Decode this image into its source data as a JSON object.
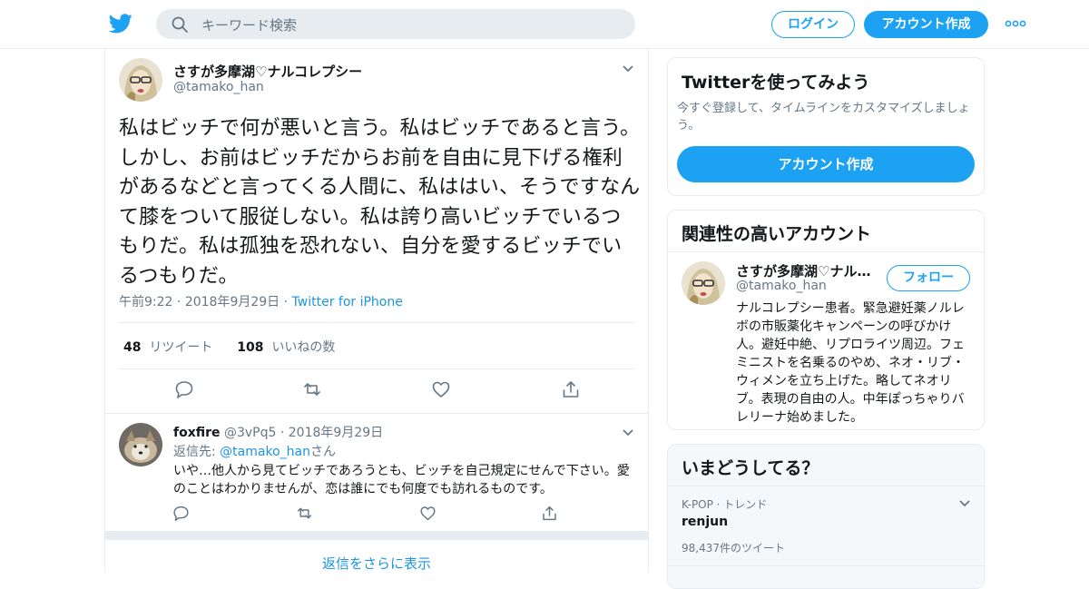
{
  "header": {
    "search_placeholder": "キーワード検索",
    "login_label": "ログイン",
    "signup_label": "アカウント作成"
  },
  "tweet": {
    "name": "さすが多摩湖♡ナルコレプシー",
    "handle": "@tamako_han",
    "text": "私はビッチで何が悪いと言う。私はビッチであると言う。しかし、お前はビッチだからお前を自由に見下げる権利があるなどと言ってくる人間に、私ははい、そうですなんて膝をついて服従しない。私は誇り高いビッチでいるつもりだ。私は孤独を恐れない、自分を愛するビッチでいるつもりだ。",
    "time": "午前9:22",
    "date": "2018年9月29日",
    "source": "Twitter for iPhone",
    "retweets_count": "48",
    "retweets_label": "リツイート",
    "likes_count": "108",
    "likes_label": "いいねの数"
  },
  "reply": {
    "name": "foxfire",
    "handle": "@3vPq5",
    "date": "2018年9月29日",
    "reply_to_prefix": "返信先:",
    "reply_to_handle": "@tamako_han",
    "reply_to_suffix": "さん",
    "text": "いや…他人から見てビッチであろうとも、ビッチを自己規定にせんで下さい。愛のことはわかりませんが、恋は誰にでも何度でも訪れるものです。"
  },
  "more_replies_label": "返信をさらに表示",
  "sidebar": {
    "try_twitter": {
      "title": "Twitterを使ってみよう",
      "description": "今すぐ登録して、タイムラインをカスタマイズしましょう。",
      "button_label": "アカウント作成"
    },
    "related": {
      "title": "関連性の高いアカウント",
      "name": "さすが多摩湖♡ナル…",
      "handle": "@tamako_han",
      "follow_label": "フォロー",
      "bio": "ナルコレプシー患者。緊急避妊薬ノルレボの市販薬化キャンペーンの呼びかけ人。避妊中絶、リプロライツ周辺。フェミニストを名乗るのやめ、ネオ・リブ・ウィメンを立ち上げた。略してネオリブ。表現の自由の人。中年ぽっちゃりバレリーナ始めました。"
    },
    "trends": {
      "title": "いまどうしてる？",
      "items": [
        {
          "meta": "K-POP · トレンド",
          "topic": "renjun",
          "count": "98,437件のツイート"
        }
      ]
    }
  },
  "colors": {
    "brand_blue": "#1da1f2",
    "link_blue": "#1b95e0",
    "text_gray": "#657786",
    "border": "#e6ecf0"
  },
  "icons": [
    "twitter-bird-icon",
    "search-icon",
    "more-dots-icon",
    "chevron-down-icon",
    "reply-icon",
    "retweet-icon",
    "like-icon",
    "share-icon"
  ]
}
